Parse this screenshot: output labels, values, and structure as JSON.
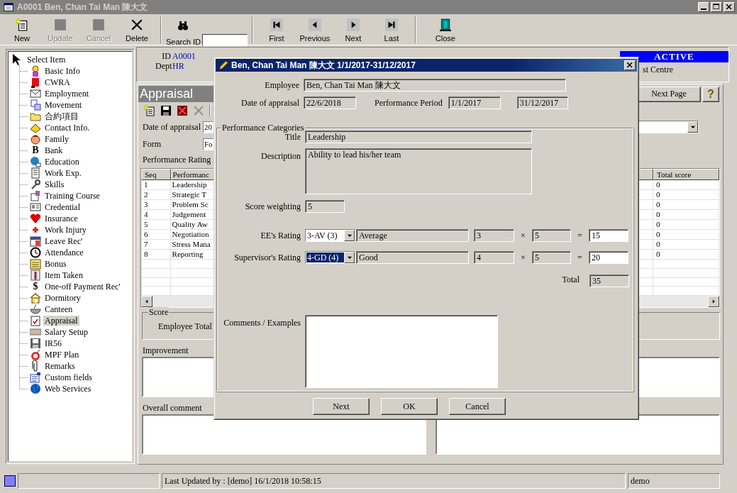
{
  "window": {
    "title": "A0001 Ben, Chan Tai Man 陳大文"
  },
  "toolbar": {
    "buttons": [
      {
        "label": "New",
        "kind": "action",
        "disabled": false
      },
      {
        "label": "Update",
        "kind": "action",
        "disabled": true
      },
      {
        "label": "Cancel",
        "kind": "action",
        "disabled": true
      },
      {
        "label": "Delete",
        "kind": "action",
        "disabled": false
      },
      {
        "label": "First",
        "kind": "nav",
        "disabled": false
      },
      {
        "label": "Previous",
        "kind": "nav",
        "disabled": false
      },
      {
        "label": "Next",
        "kind": "nav",
        "disabled": false
      },
      {
        "label": "Last",
        "kind": "nav",
        "disabled": false
      },
      {
        "label": "Close",
        "kind": "close",
        "disabled": false
      }
    ],
    "search": {
      "label": "Search ID"
    }
  },
  "sidebar": {
    "root": "Select Item",
    "items": [
      {
        "label": "Basic Info",
        "selected": false
      },
      {
        "label": "CWRA",
        "selected": false
      },
      {
        "label": "Employment",
        "selected": false
      },
      {
        "label": "Movement",
        "selected": false
      },
      {
        "label": "合約項目",
        "selected": false
      },
      {
        "label": "Contact Info.",
        "selected": false
      },
      {
        "label": "Family",
        "selected": false
      },
      {
        "label": "Bank",
        "selected": false,
        "glyph": "B"
      },
      {
        "label": "Education",
        "selected": false
      },
      {
        "label": "Work Exp.",
        "selected": false
      },
      {
        "label": "Skills",
        "selected": false
      },
      {
        "label": "Training Course",
        "selected": false
      },
      {
        "label": "Credential",
        "selected": false
      },
      {
        "label": "Insurance",
        "selected": false
      },
      {
        "label": "Work Injury",
        "selected": false
      },
      {
        "label": "Leave Rec'",
        "selected": false
      },
      {
        "label": "Attendance",
        "selected": false
      },
      {
        "label": "Bonus",
        "selected": false
      },
      {
        "label": "Item Taken",
        "selected": false
      },
      {
        "label": "One-off Payment Rec'",
        "selected": false,
        "glyph": "$"
      },
      {
        "label": "Dormitory",
        "selected": false
      },
      {
        "label": "Canteen",
        "selected": false
      },
      {
        "label": "Appraisal",
        "selected": true
      },
      {
        "label": "Salary Setup",
        "selected": false
      },
      {
        "label": "IR56",
        "selected": false
      },
      {
        "label": "MPF Plan",
        "selected": false
      },
      {
        "label": "Remarks",
        "selected": false
      },
      {
        "label": "Custom fields",
        "selected": false
      },
      {
        "label": "Web Services",
        "selected": false
      }
    ]
  },
  "employee": {
    "id_label": "ID",
    "id": "A0001",
    "dept_label": "Dept",
    "dept": "HR",
    "status": "ACTIVE",
    "cost_centre_label": "st Centre"
  },
  "appraisal": {
    "title": "Appraisal",
    "next_page": "Next Page",
    "help": "?",
    "date_label": "Date of appraisal",
    "date_value": "20",
    "form_label": "Form",
    "form_value": "Fo",
    "rating_label": "Performance Rating",
    "table": {
      "columns": [
        "Seq",
        "Performanc",
        "Total score"
      ],
      "rows": [
        {
          "seq": "1",
          "performance": "Leadership",
          "total": "0"
        },
        {
          "seq": "2",
          "performance": "Strategic T",
          "total": "0"
        },
        {
          "seq": "3",
          "performance": "Problem Sc",
          "total": "0"
        },
        {
          "seq": "4",
          "performance": "Judgement",
          "total": "0"
        },
        {
          "seq": "5",
          "performance": "Quality Aw",
          "total": "0"
        },
        {
          "seq": "6",
          "performance": "Negotiation",
          "total": "0"
        },
        {
          "seq": "7",
          "performance": "Stress Mana",
          "total": "0"
        },
        {
          "seq": "8",
          "performance": "Reporting",
          "total": "0"
        }
      ]
    },
    "score_label": "Score",
    "employee_total": "Employee Total",
    "improvement_label": "Improvement",
    "overall_label": "Overall comment"
  },
  "dialog": {
    "title": "Ben, Chan Tai Man 陳大文 1/1/2017-31/12/2017",
    "employee_label": "Employee",
    "employee": "Ben, Chan Tai Man 陳大文",
    "date_label": "Date of appraisal",
    "date": "22/6/2018",
    "period_label": "Performance Period",
    "period_from": "1/1/2017",
    "period_to": "31/12/2017",
    "group_label": "Performance Categories",
    "title_label": "Title",
    "category_title": "Leadership",
    "description_label": "Description",
    "description": "Ability to lead his/her team",
    "weighting_label": "Score weighting",
    "weighting": "5",
    "ratings": [
      {
        "label": "EE's Rating",
        "code": "3-AV (3)",
        "focused": false,
        "name": "Average",
        "score": "3",
        "times": "×",
        "weight": "5",
        "equals": "=",
        "result": "15"
      },
      {
        "label": "Supervisor's Rating",
        "code": "4-GD (4)",
        "focused": true,
        "name": "Good",
        "score": "4",
        "times": "×",
        "weight": "5",
        "equals": "=",
        "result": "20"
      }
    ],
    "total_label": "Total",
    "total": "35",
    "comments_label": "Comments / Examples",
    "buttons": [
      "Next",
      "OK",
      "Cancel"
    ]
  },
  "status_bar": {
    "updated": "Last Updated by : [demo]  16/1/2018 10:58:15",
    "user": "demo"
  }
}
